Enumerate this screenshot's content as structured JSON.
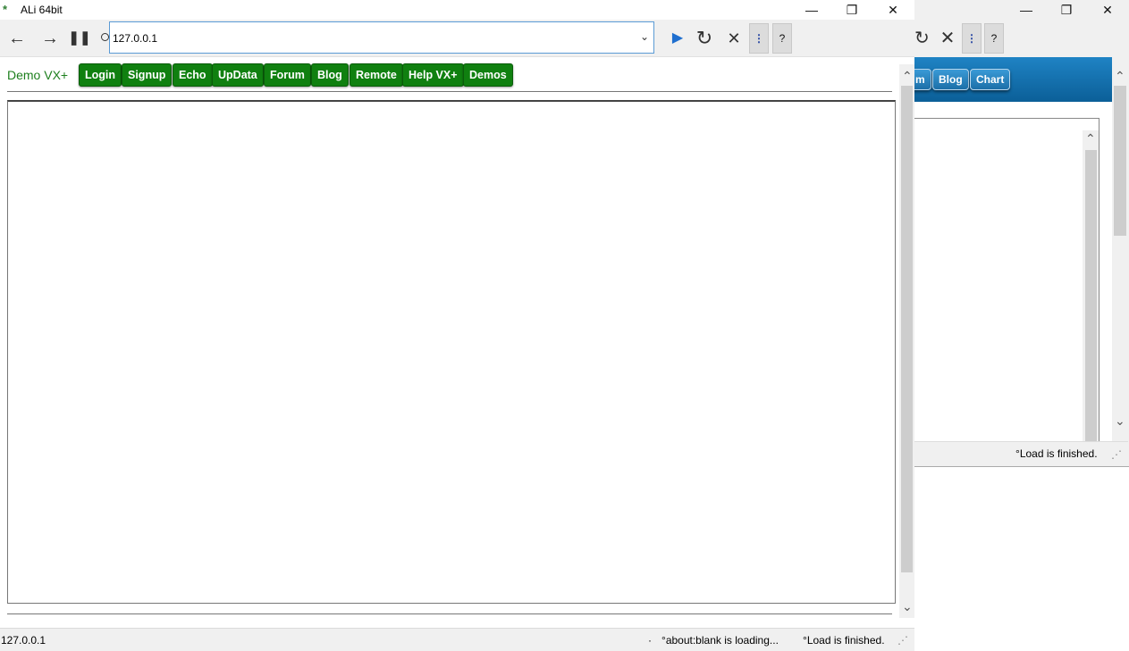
{
  "window": {
    "title": "ALi 64bit",
    "app_icon": "ali-app-icon",
    "minimize_icon": "minimize-icon",
    "restore_icon": "restore-icon",
    "close_icon": "close-icon"
  },
  "toolbar": {
    "back_icon": "arrow-left-icon",
    "forward_icon": "arrow-right-icon",
    "pause_icon": "pause-icon",
    "go_icon": "play-triangle-icon",
    "reload_icon": "reload-icon",
    "stop_icon": "stop-x-icon",
    "menu_label": "⋮",
    "help_label": "?"
  },
  "address": {
    "value": "127.0.0.1",
    "dropdown_icon": "chevron-down-icon"
  },
  "nav": {
    "brand": "Demo VX+",
    "buttons": [
      "Login",
      "Signup",
      "Echo",
      "UpData",
      "Forum",
      "Blog",
      "Remote",
      "Help VX+",
      "Demos"
    ]
  },
  "status": {
    "url": "127.0.0.1",
    "dot": "·",
    "loading": "about:blank is loading...",
    "finished": "Load is finished."
  },
  "back_window": {
    "partial_tab": "m",
    "buttons": [
      "Blog",
      "Chart"
    ],
    "menu_label": "⋮",
    "help_label": "?",
    "status": "Load is finished."
  },
  "colors": {
    "nav_button": "#108010",
    "brand_text": "#1d7f1d",
    "back_banner": "#0b5f98",
    "url_border": "#5b9bd5"
  }
}
